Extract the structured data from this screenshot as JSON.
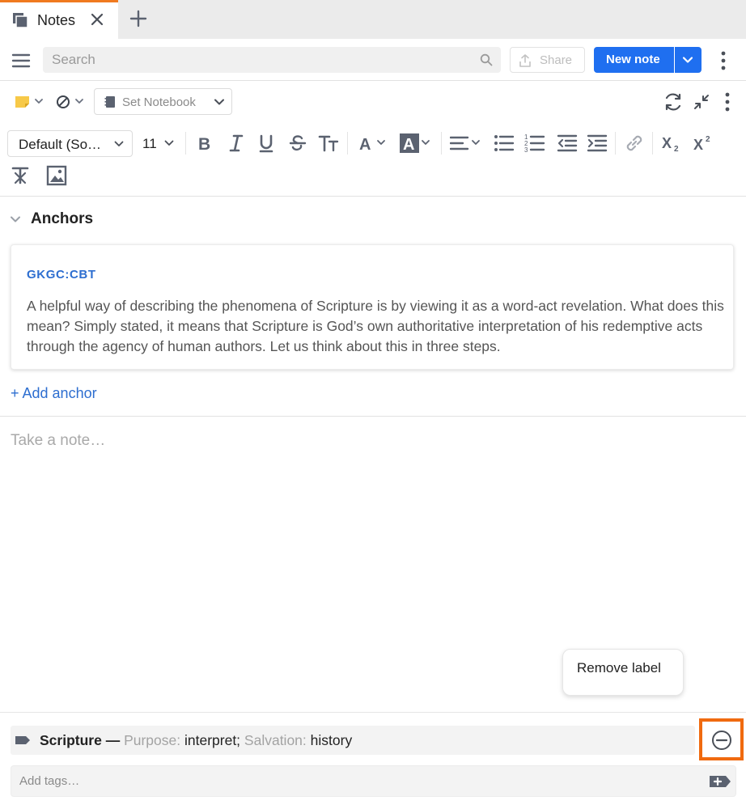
{
  "tab": {
    "label": "Notes"
  },
  "search": {
    "placeholder": "Search"
  },
  "toolbar": {
    "share_label": "Share",
    "new_note_label": "New note"
  },
  "note_settings": {
    "notebook_label": "Set Notebook"
  },
  "format": {
    "font_family": "Default (So…",
    "font_size": "11"
  },
  "anchors": {
    "title": "Anchors",
    "items": [
      {
        "source": "GKGC:CBT",
        "text": "A helpful way of describing the phenomena of Scripture is by viewing it as a word-act revelation. What does this mean? Simply stated, it means that Scripture is God’s own authoritative interpretation of his redemptive acts through the agency of human authors. Let us think about this in three steps."
      }
    ],
    "add_label": "+ Add anchor"
  },
  "note": {
    "placeholder": "Take a note…"
  },
  "tooltip": {
    "text": "Remove label"
  },
  "label": {
    "name": "Scripture",
    "separator": " — ",
    "field1_key": "Purpose:",
    "field1_value": "interpret;",
    "field2_key": "Salvation:",
    "field2_value": "history"
  },
  "tags": {
    "placeholder": "Add tags…"
  },
  "colors": {
    "accent_blue": "#1f6ff0",
    "tab_accent": "#f07a1f",
    "highlight_orange": "#f06a0f",
    "icon_gray": "#5b6270",
    "note_yellow": "#f7c948"
  },
  "icons": [
    "notes-icon",
    "close-icon",
    "plus-icon",
    "menu-icon",
    "search-icon",
    "share-icon",
    "chevron-down-icon",
    "kebab-icon",
    "sticky-note-icon",
    "no-visibility-icon",
    "notebook-icon",
    "sync-icon",
    "collapse-icon",
    "bold-icon",
    "italic-icon",
    "underline-icon",
    "strikethrough-icon",
    "text-size-icon",
    "text-color-icon",
    "highlight-icon",
    "align-icon",
    "bullet-list-icon",
    "numbered-list-icon",
    "outdent-icon",
    "indent-icon",
    "link-icon",
    "subscript-icon",
    "superscript-icon",
    "clear-format-icon",
    "image-icon",
    "label-icon",
    "remove-circle-icon",
    "add-tag-icon"
  ]
}
